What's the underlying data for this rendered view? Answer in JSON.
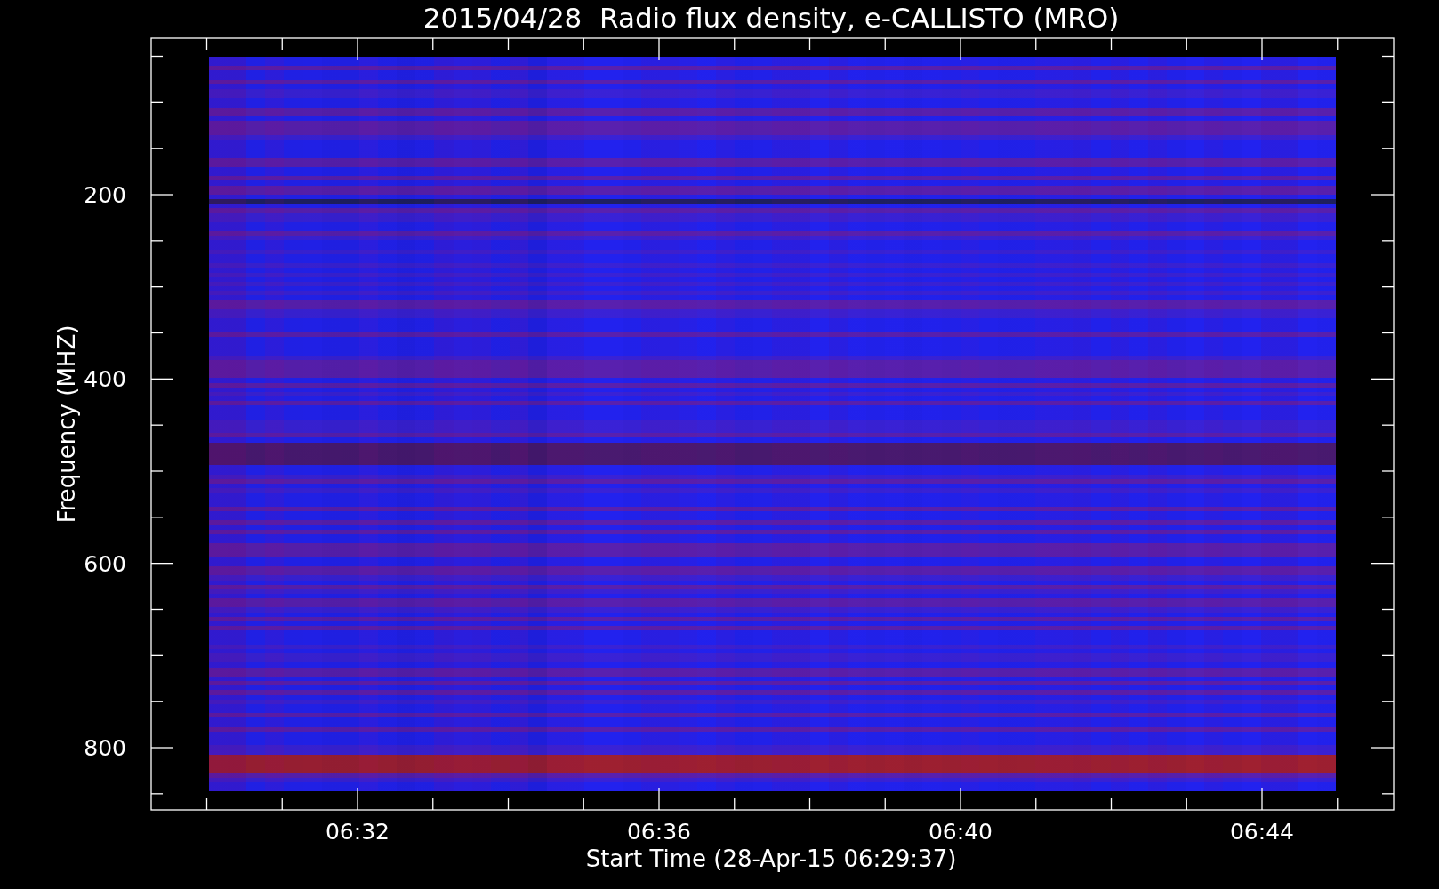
{
  "title": "2015/04/28  Radio flux density, e-CALLISTO (MRO)",
  "plot": {
    "ylabel": "Frequency (MHZ)",
    "xlabel": "Start Time (28-Apr-15 06:29:37)",
    "yticks": [
      "200",
      "400",
      "600",
      "800"
    ],
    "xticks": [
      "06:32",
      "06:36",
      "06:40",
      "06:44"
    ]
  }
}
